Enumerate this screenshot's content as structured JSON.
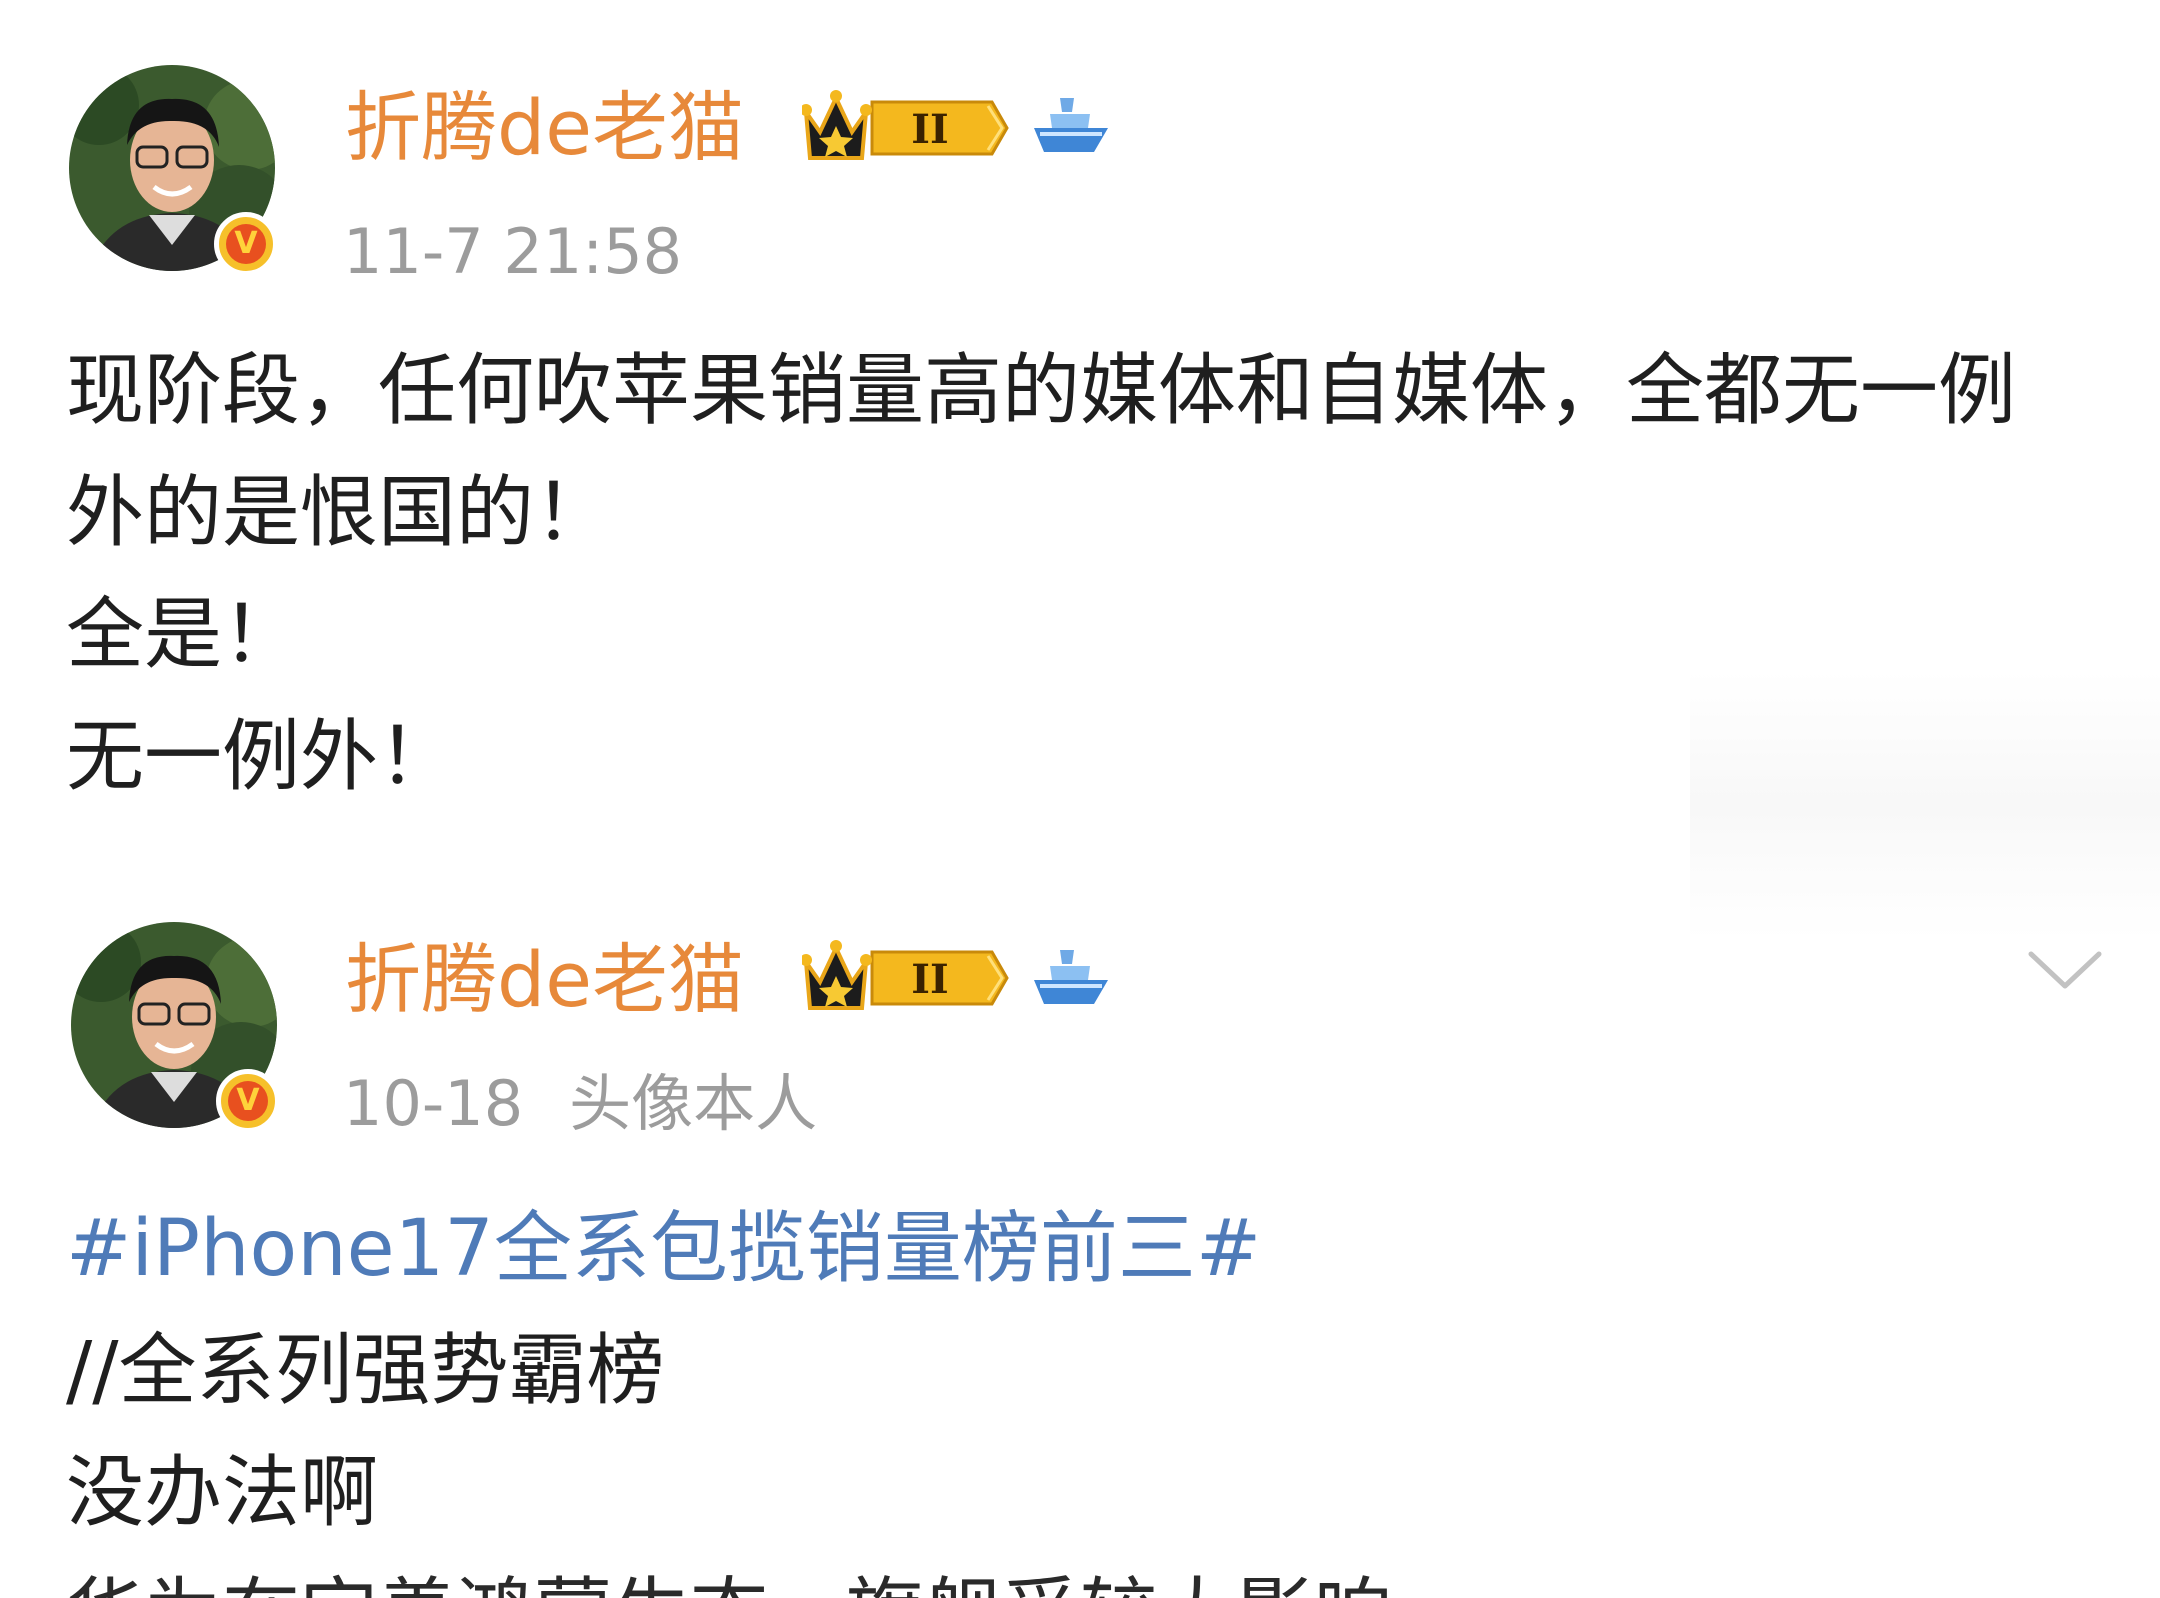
{
  "posts": [
    {
      "username": "折腾de老猫",
      "timestamp": "11-7 21:58",
      "source": "",
      "verified_icon": "v-badge-icon",
      "level_badge": "crown-level-II-icon",
      "level_text": "II",
      "extra_icon": "blue-ship-icon",
      "lines": [
        "现阶段，任何吹苹果销量高的媒体和自媒体，全都无一例",
        "外的是恨国的！",
        "全是！",
        "无一例外！"
      ]
    },
    {
      "username": "折腾de老猫",
      "timestamp": "10-18",
      "source": "头像本人",
      "verified_icon": "v-badge-icon",
      "level_badge": "crown-level-II-icon",
      "level_text": "II",
      "extra_icon": "blue-ship-icon",
      "hashtag": "#iPhone17全系包揽销量榜前三#",
      "lines": [
        "//全系列强势霸榜",
        "没办法啊",
        "华为在完善鸿蒙生态，旗舰受较大影响"
      ]
    }
  ],
  "expand_icon": "chevron-down-icon",
  "colors": {
    "username": "#e7893a",
    "meta": "#9c9c9c",
    "hashtag": "#4f7bb8",
    "text": "#1f1f1f",
    "badge_gold": "#f6c02a",
    "badge_red": "#e8501f"
  }
}
